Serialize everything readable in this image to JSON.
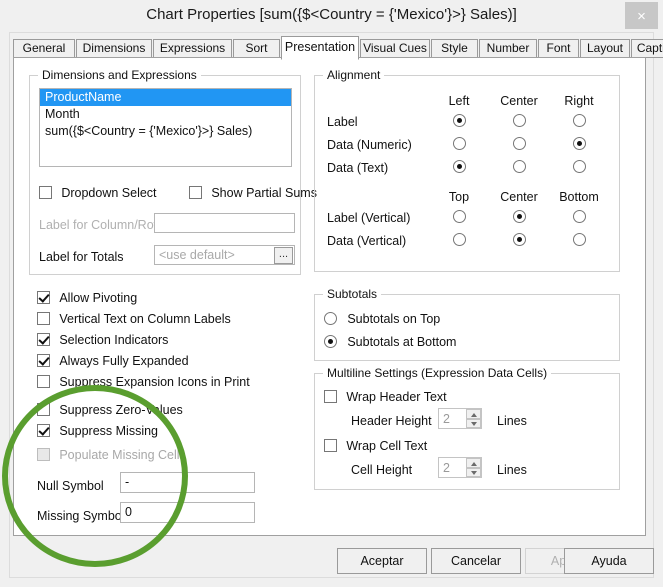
{
  "window": {
    "title": "Chart Properties [sum({$<Country = {'Mexico'}>} Sales)]",
    "close_label": "×"
  },
  "tabs": [
    {
      "label": "General",
      "active": false
    },
    {
      "label": "Dimensions",
      "active": false
    },
    {
      "label": "Expressions",
      "active": false
    },
    {
      "label": "Sort",
      "active": false
    },
    {
      "label": "Presentation",
      "active": true
    },
    {
      "label": "Visual Cues",
      "active": false
    },
    {
      "label": "Style",
      "active": false
    },
    {
      "label": "Number",
      "active": false
    },
    {
      "label": "Font",
      "active": false
    },
    {
      "label": "Layout",
      "active": false
    },
    {
      "label": "Caption",
      "active": false
    }
  ],
  "dimensions_group": {
    "title": "Dimensions and Expressions",
    "items": [
      {
        "label": "ProductName",
        "selected": true
      },
      {
        "label": "Month",
        "selected": false
      },
      {
        "label": "sum({$<Country = {'Mexico'}>} Sales)",
        "selected": false
      }
    ],
    "dropdown_select": {
      "label": "Dropdown Select",
      "checked": false
    },
    "show_partial_sums": {
      "label": "Show Partial Sums",
      "checked": false
    },
    "label_for_column_row": {
      "label": "Label for Column/Row",
      "value": "",
      "enabled": false
    },
    "label_for_totals": {
      "label": "Label for Totals",
      "placeholder": "<use default>",
      "value": "",
      "browse": "..."
    }
  },
  "alignment_group": {
    "title": "Alignment",
    "h_headers": [
      "Left",
      "Center",
      "Right"
    ],
    "v_headers": [
      "Top",
      "Center",
      "Bottom"
    ],
    "h_rows": [
      {
        "label": "Label",
        "selected": 0
      },
      {
        "label": "Data (Numeric)",
        "selected": 2
      },
      {
        "label": "Data (Text)",
        "selected": 0
      }
    ],
    "v_rows": [
      {
        "label": "Label (Vertical)",
        "selected": 1
      },
      {
        "label": "Data (Vertical)",
        "selected": 1
      }
    ]
  },
  "options": [
    {
      "label": "Allow Pivoting",
      "checked": true,
      "enabled": true
    },
    {
      "label": "Vertical Text on Column Labels",
      "checked": false,
      "enabled": true
    },
    {
      "label": "Selection Indicators",
      "checked": true,
      "enabled": true
    },
    {
      "label": "Always Fully Expanded",
      "checked": true,
      "enabled": true
    },
    {
      "label": "Suppress Expansion Icons in Print",
      "checked": false,
      "enabled": true
    },
    {
      "label": "Suppress Zero-Values",
      "checked": false,
      "enabled": true
    },
    {
      "label": "Suppress Missing",
      "checked": true,
      "enabled": true
    },
    {
      "label": "Populate Missing Cells",
      "checked": false,
      "enabled": false
    }
  ],
  "symbols": {
    "null_symbol": {
      "label": "Null Symbol",
      "value": "-"
    },
    "missing_symbol": {
      "label": "Missing Symbol",
      "value": "0"
    }
  },
  "subtotals_group": {
    "title": "Subtotals",
    "options": [
      {
        "label": "Subtotals on Top",
        "selected": false
      },
      {
        "label": "Subtotals at Bottom",
        "selected": true
      }
    ]
  },
  "multiline_group": {
    "title": "Multiline Settings (Expression Data Cells)",
    "wrap_header_text": {
      "label": "Wrap Header Text",
      "checked": false
    },
    "header_height": {
      "label": "Header Height",
      "value": "2",
      "unit": "Lines"
    },
    "wrap_cell_text": {
      "label": "Wrap Cell Text",
      "checked": false
    },
    "cell_height": {
      "label": "Cell Height",
      "value": "2",
      "unit": "Lines"
    }
  },
  "buttons": [
    {
      "label": "Aceptar",
      "enabled": true
    },
    {
      "label": "Cancelar",
      "enabled": true
    },
    {
      "label": "Aplicar",
      "enabled": false
    },
    {
      "label": "Ayuda",
      "enabled": true
    }
  ],
  "annotation": {
    "shape": "ellipse",
    "color": "#5a9e2f"
  }
}
